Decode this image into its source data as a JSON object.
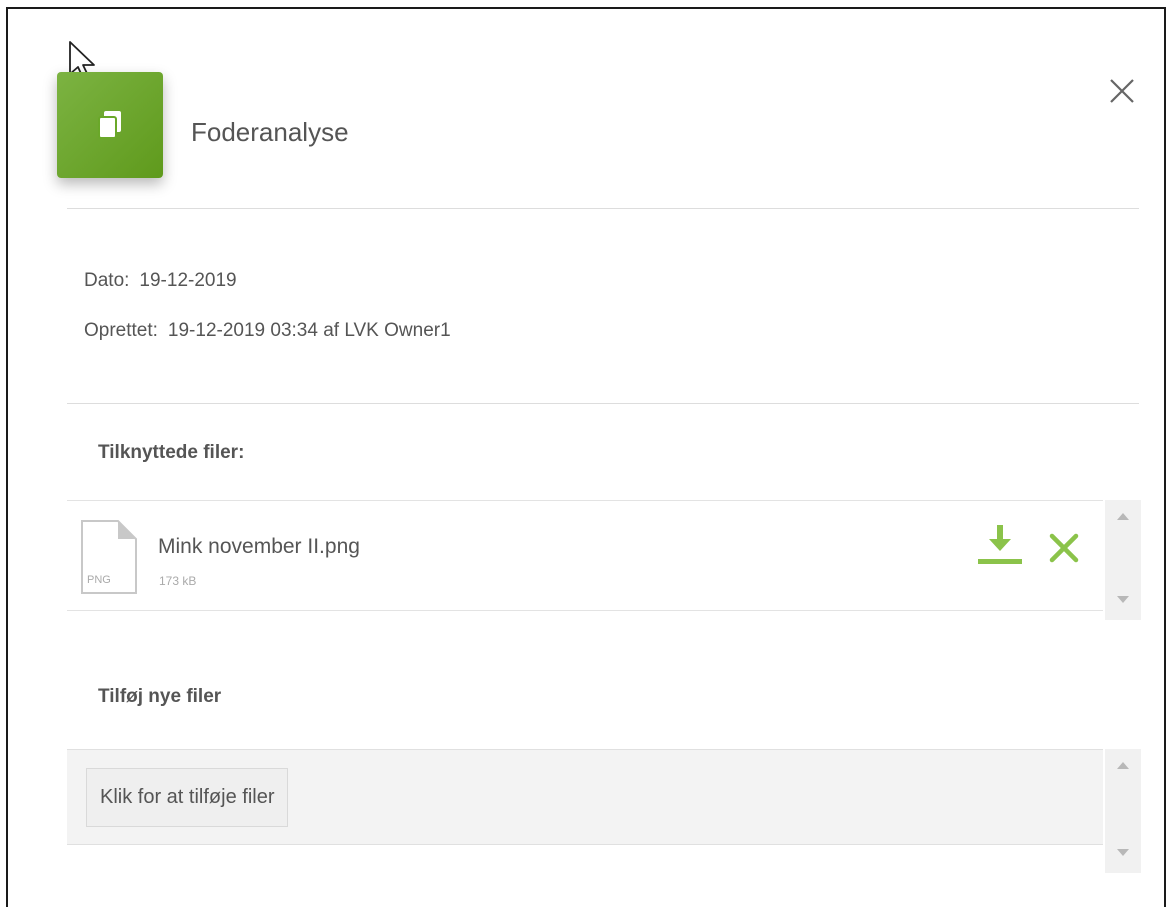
{
  "header": {
    "title": "Foderanalyse",
    "icon": "documents-icon",
    "accent_color": "#6aa829"
  },
  "meta": {
    "date_label": "Dato:",
    "date_value": "19-12-2019",
    "created_label": "Oprettet:",
    "created_value": "19-12-2019 03:34 af LVK Owner1"
  },
  "attached": {
    "title": "Tilknyttede filer:",
    "files": [
      {
        "name": "Mink november II.png",
        "size": "173 kB",
        "type": "PNG"
      }
    ]
  },
  "add_files": {
    "title": "Tilføj nye filer",
    "button_label": "Klik for at tilføje filer"
  },
  "colors": {
    "action_green": "#8bc34a",
    "text": "#555555",
    "muted": "#aaaaaa"
  }
}
